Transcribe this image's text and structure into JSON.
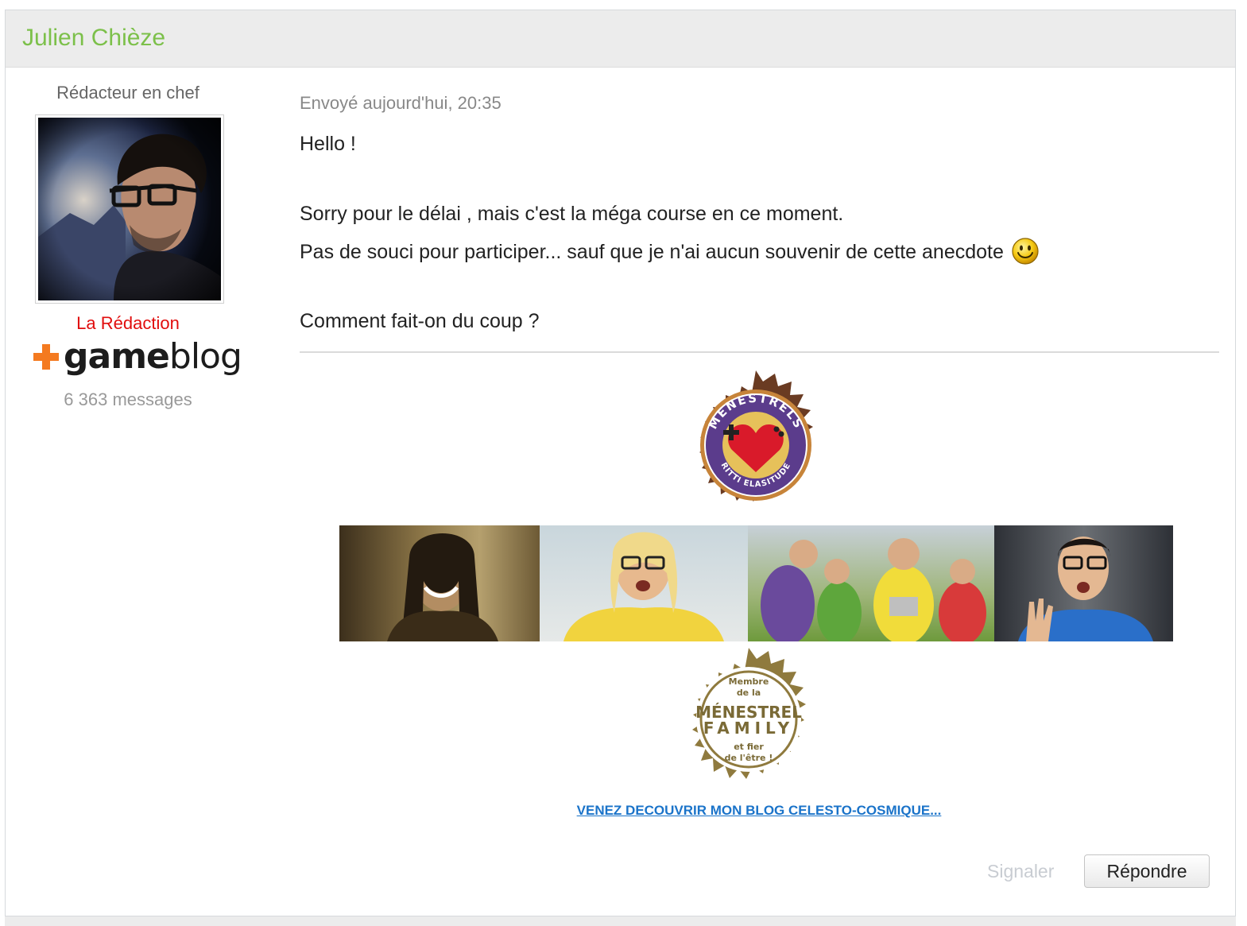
{
  "post": {
    "author_name": "Julien Chièze",
    "member_title": "Rédacteur en chef",
    "group_name": "La Rédaction",
    "brand_logo": "gameblog",
    "message_count": "6 363 messages",
    "date": "Envoyé aujourd'hui, 20:35",
    "body": {
      "line1": "Hello !",
      "line2": "Sorry pour le délai  , mais c'est la méga course en ce moment.",
      "line3": "Pas de souci pour participer... sauf que je n'ai aucun souvenir de cette anecdote",
      "line4": "Comment fait-on du coup ?"
    },
    "icons": {
      "smiley": "smiley-icon",
      "plus": "plus-icon"
    }
  },
  "signature": {
    "badge_top_text": "MENESTRELS",
    "badge_top_sub": "RITTI ELASITUDE",
    "badge_bottom_lines": [
      "Membre",
      "de la",
      "MÉNESTREL",
      "FAMILY",
      "et fier",
      "de l'être !"
    ],
    "blog_link": "VENEZ DECOUVRIR MON BLOG CELESTO-COSMIQUE..."
  },
  "actions": {
    "report_label": "Signaler",
    "reply_label": "Répondre"
  },
  "colors": {
    "author": "#7cc04a",
    "group": "#e10d0d",
    "brand_orange": "#f47a20",
    "link": "#1a73c9"
  }
}
